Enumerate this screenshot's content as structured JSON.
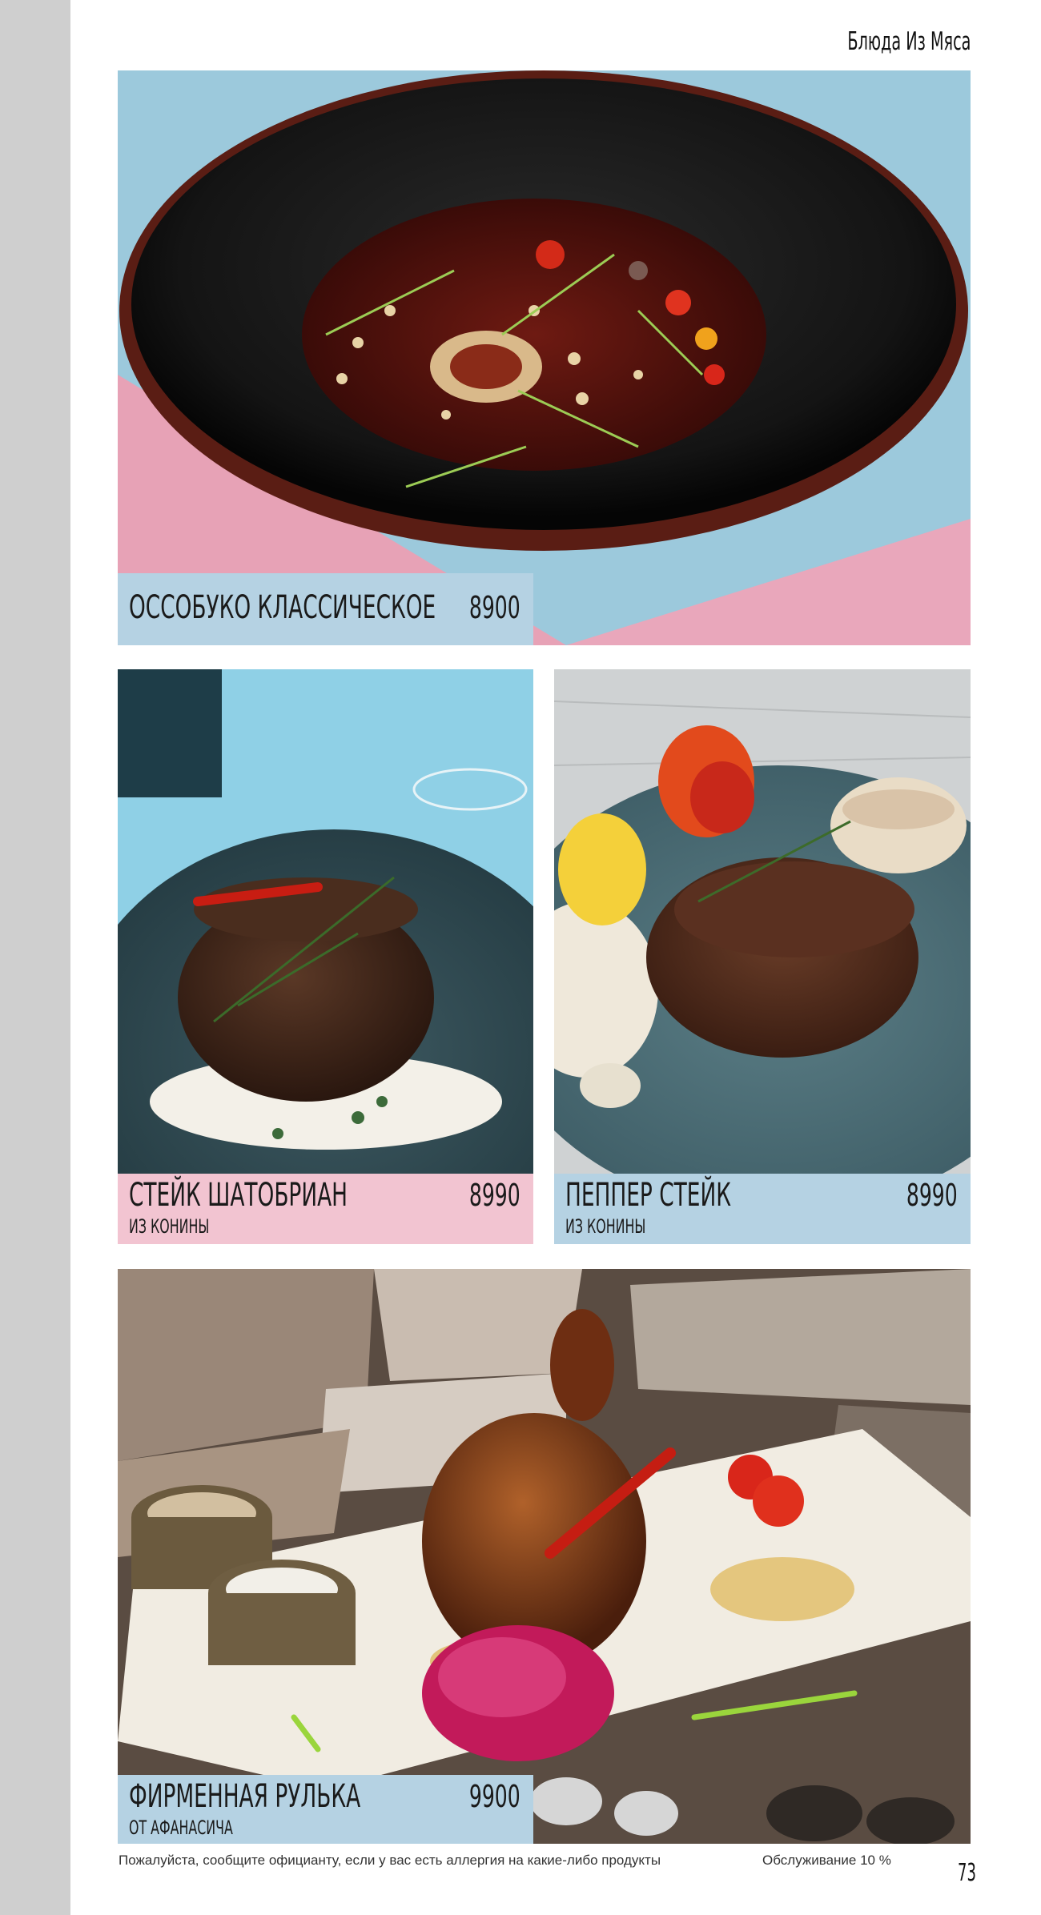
{
  "header": {
    "section_title": "Блюда Из Мяса"
  },
  "dishes": [
    {
      "name": "ОССОБУКО КЛАССИЧЕСКОЕ",
      "price": "8900",
      "subtitle": "",
      "caption_color": "#b5d2e3",
      "photo": "ossobuco-photo"
    },
    {
      "name": "СТЕЙК ШАТОБРИАН",
      "price": "8990",
      "subtitle": "ИЗ КОНИНЫ",
      "caption_color": "#f2c4d1",
      "photo": "chateaubriand-photo"
    },
    {
      "name": "ПЕППЕР СТЕЙК",
      "price": "8990",
      "subtitle": "ИЗ КОНИНЫ",
      "caption_color": "#b5d2e3",
      "photo": "pepper-steak-photo"
    },
    {
      "name": "ФИРМЕННАЯ РУЛЬКА",
      "price": "9900",
      "subtitle": "ОТ АФАНАСИЧА",
      "caption_color": "#b5d2e3",
      "photo": "pork-knuckle-photo"
    }
  ],
  "footer": {
    "allergy_note": "Пожалуйста, сообщите официанту, если у вас есть аллергия на какие-либо продукты",
    "service_charge": "Обслуживание 10 %",
    "page_number": "73"
  },
  "colors": {
    "sidebar_gray": "#cfcfcf",
    "caption_blue": "#b5d2e3",
    "caption_pink": "#f2c4d1",
    "text": "#1a1a1a"
  }
}
